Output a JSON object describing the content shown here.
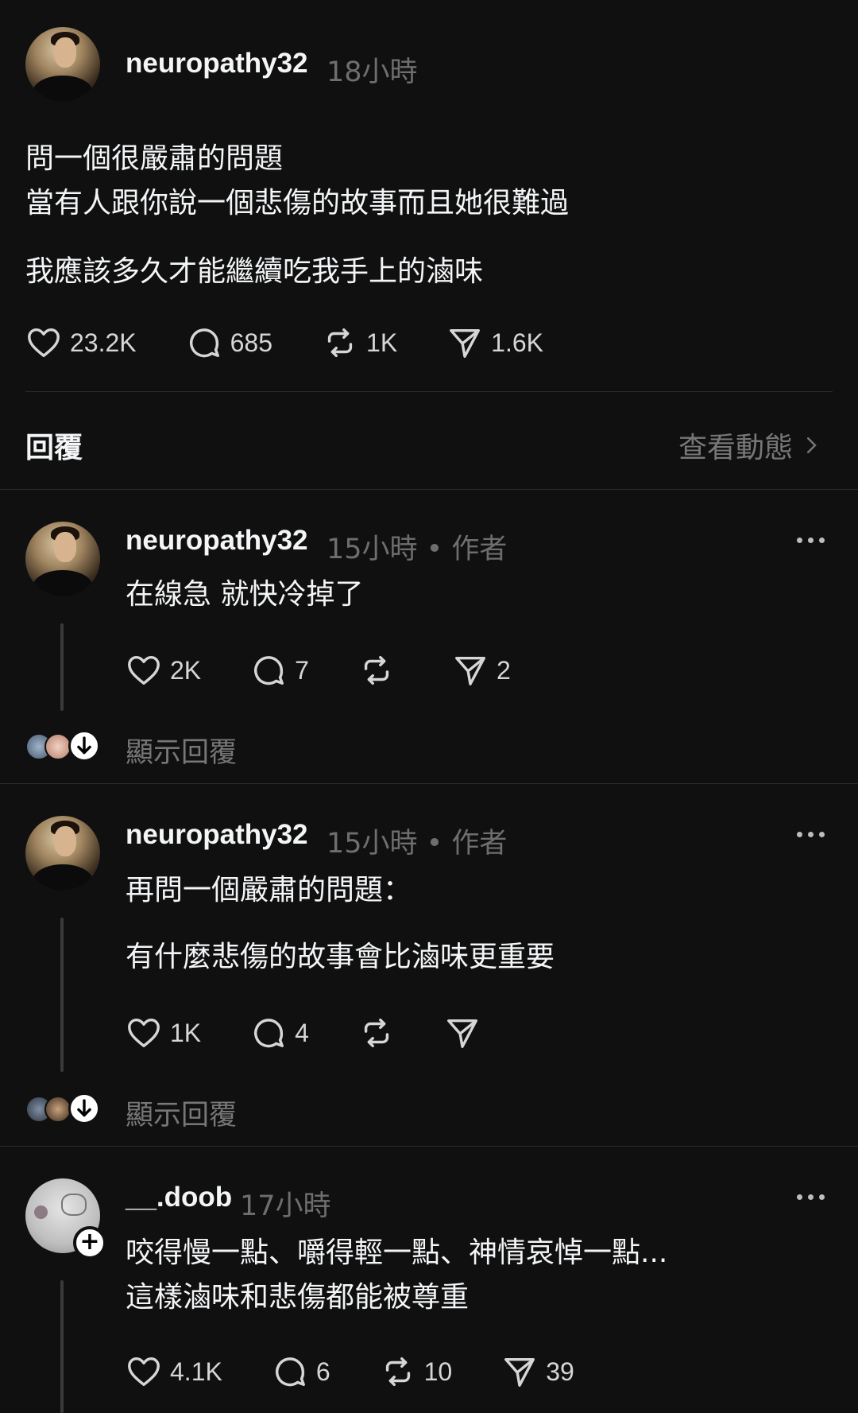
{
  "main_post": {
    "username": "neuropathy32",
    "time": "18小時",
    "lines": [
      "問一個很嚴肅的問題",
      "當有人跟你說一個悲傷的故事而且她很難過",
      "我應該多久才能繼續吃我手上的滷味"
    ],
    "likes": "23.2K",
    "comments": "685",
    "reposts": "1K",
    "shares": "1.6K"
  },
  "replies_header": {
    "title": "回覆",
    "activity_link": "查看動態"
  },
  "replies": [
    {
      "username": "neuropathy32",
      "time": "15小時 • 作者",
      "lines": [
        "在線急 就快冷掉了"
      ],
      "likes": "2K",
      "comments": "7",
      "reposts": "",
      "shares": "2",
      "show_replies": "顯示回覆"
    },
    {
      "username": "neuropathy32",
      "time": "15小時 • 作者",
      "lines": [
        "再問一個嚴肅的問題：",
        "有什麼悲傷的故事會比滷味更重要"
      ],
      "likes": "1K",
      "comments": "4",
      "reposts": "",
      "shares": "",
      "show_replies": "顯示回覆"
    },
    {
      "username": "__.doob",
      "time": "17小時",
      "lines": [
        "咬得慢一點、嚼得輕一點、神情哀悼一點...",
        "這樣滷味和悲傷都能被尊重"
      ],
      "likes": "4.1K",
      "comments": "6",
      "reposts": "10",
      "shares": "39"
    }
  ],
  "icons": {
    "like": "heart-icon",
    "comment": "comment-bubble-icon",
    "repost": "repost-icon",
    "share": "send-icon",
    "more": "more-dots-icon",
    "chevron": "chevron-right-icon",
    "follow": "plus-icon",
    "expand": "arrow-down-icon"
  },
  "colors": {
    "background": "#101010",
    "text": "#f3f5f7",
    "secondary_text": "#777777"
  }
}
